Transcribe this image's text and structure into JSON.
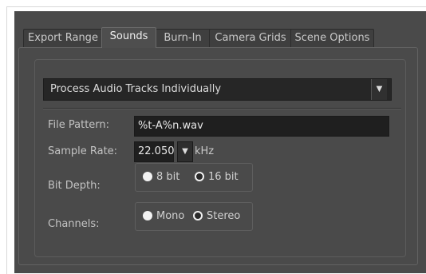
{
  "tabs": [
    {
      "label": "Export Range",
      "active": false
    },
    {
      "label": "Sounds",
      "active": true
    },
    {
      "label": "Burn-In",
      "active": false
    },
    {
      "label": "Camera Grids",
      "active": false
    },
    {
      "label": "Scene Options",
      "active": false
    }
  ],
  "mode_dropdown": {
    "value": "Process Audio Tracks Individually"
  },
  "file_pattern": {
    "label": "File Pattern:",
    "value": "%t-A%n.wav"
  },
  "sample_rate": {
    "label": "Sample Rate:",
    "value": "22.050",
    "unit": "kHz"
  },
  "bit_depth": {
    "label": "Bit Depth:",
    "options": [
      {
        "label": "8 bit",
        "selected": false
      },
      {
        "label": "16 bit",
        "selected": true
      }
    ]
  },
  "channels": {
    "label": "Channels:",
    "options": [
      {
        "label": "Mono",
        "selected": false
      },
      {
        "label": "Stereo",
        "selected": true
      }
    ]
  },
  "icons": {
    "dropdown_arrow": "▼",
    "rate_arrow": "▼"
  },
  "colors": {
    "dialog_bg": "#4a4a4a",
    "field_bg": "#1f1f1f",
    "text": "#dcdcdc"
  }
}
